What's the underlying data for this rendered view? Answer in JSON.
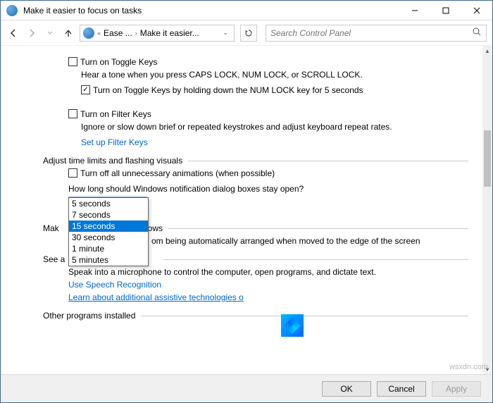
{
  "window": {
    "title": "Make it easier to focus on tasks"
  },
  "nav": {
    "breadcrumb1": "Ease ...",
    "breadcrumb2": "Make it easier...",
    "search_placeholder": "Search Control Panel"
  },
  "sections": {
    "toggle_keys": {
      "checkbox_label": "Turn on Toggle Keys",
      "description": "Hear a tone when you press CAPS LOCK, NUM LOCK, or SCROLL LOCK.",
      "sub_checkbox_label": "Turn on Toggle Keys by holding down the NUM LOCK key for 5 seconds"
    },
    "filter_keys": {
      "checkbox_label": "Turn on Filter Keys",
      "description": "Ignore or slow down brief or repeated keystrokes and adjust keyboard repeat rates.",
      "link": "Set up Filter Keys"
    },
    "time_limits": {
      "header": "Adjust time limits and flashing visuals",
      "checkbox_label": "Turn off all unnecessary animations (when possible)",
      "question": "How long should Windows notification dialog boxes stay open?",
      "selected": "5 seconds",
      "options": [
        "5 seconds",
        "7 seconds",
        "15 seconds",
        "30 seconds",
        "1 minute",
        "5 minutes"
      ],
      "highlighted": "15 seconds"
    },
    "windows": {
      "header_partial": "indows",
      "prevent_text": "om being automatically arranged when moved to the edge of the screen"
    },
    "see_also": {
      "header_prefix": "See a",
      "speak_text": "Speak into a microphone to control the computer, open programs, and dictate text.",
      "link1": "Use Speech Recognition",
      "link2": "Learn about additional assistive technologies o"
    },
    "other": {
      "header": "Other programs installed"
    }
  },
  "footer": {
    "ok": "OK",
    "cancel": "Cancel",
    "apply": "Apply"
  },
  "watermark": "wsxdn.com",
  "make_prefix": "Mak"
}
